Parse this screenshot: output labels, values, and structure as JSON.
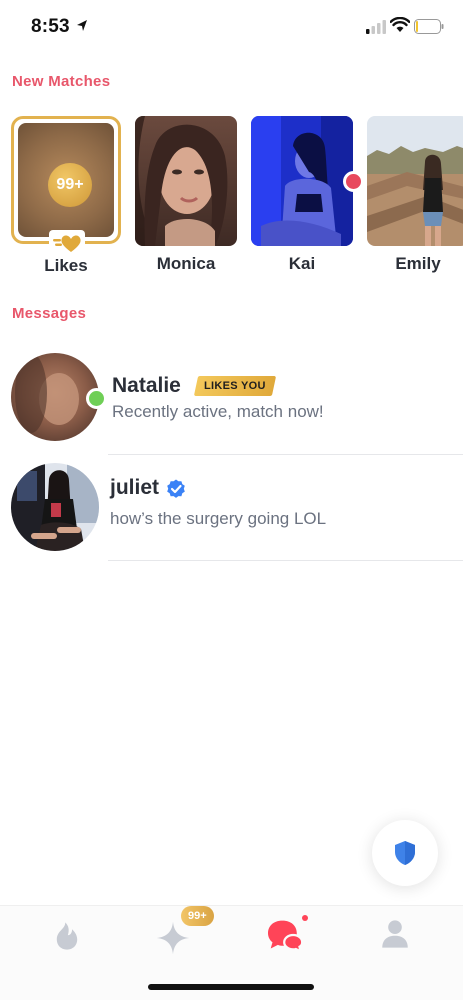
{
  "status_bar": {
    "time": "8:53"
  },
  "sections": {
    "new_matches": "New Matches",
    "messages": "Messages"
  },
  "likes": {
    "count_badge": "99+",
    "label": "Likes"
  },
  "matches": [
    {
      "name": "Monica"
    },
    {
      "name": "Kai",
      "new_indicator": true
    },
    {
      "name": "Emily"
    }
  ],
  "messages": [
    {
      "name": "Natalie",
      "badge": "LIKES YOU",
      "preview": "Recently active, match now!",
      "online": true
    },
    {
      "name": "juliet",
      "verified": true,
      "preview": "how’s the surgery going LOL"
    }
  ],
  "tabbar": {
    "explore_badge": "99+",
    "icons": [
      "flame-icon",
      "sparkle-icon",
      "chat-icon",
      "profile-icon"
    ],
    "active": "chat-icon"
  },
  "colors": {
    "accent": "#e8576b",
    "gold": "#e2b24f",
    "online": "#6fcf56",
    "verified": "#3b82f6"
  }
}
